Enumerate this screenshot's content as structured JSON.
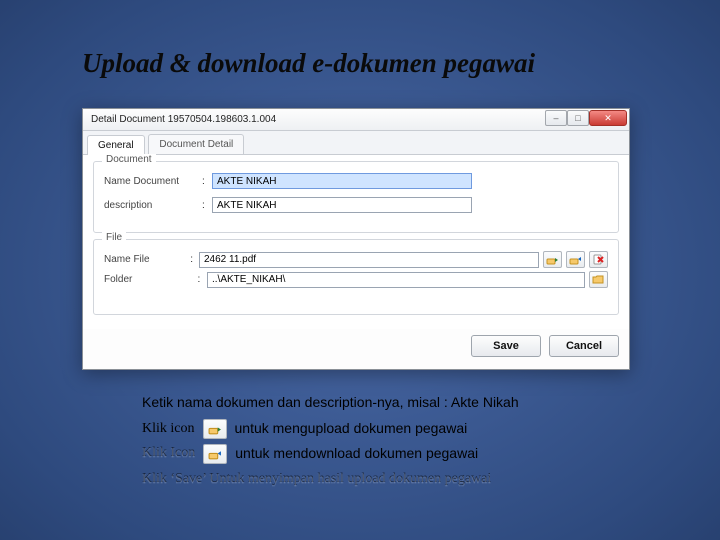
{
  "slide": {
    "title": "Upload & download e-dokumen pegawai"
  },
  "dialog": {
    "title": "Detail Document 19570504.198603.1.004",
    "tabs": {
      "general": "General",
      "detail": "Document Detail"
    },
    "group_document": "Document",
    "group_file": "File",
    "labels": {
      "name_document": "Name Document",
      "description": "description",
      "name_file": "Name File",
      "folder": "Folder",
      "colon": ":"
    },
    "values": {
      "name_document": "AKTE NIKAH",
      "description": "AKTE NIKAH",
      "name_file": "2462 11.pdf",
      "folder": "..\\AKTE_NIKAH\\"
    },
    "buttons": {
      "save": "Save",
      "cancel": "Cancel"
    }
  },
  "notes": {
    "line1": "Ketik nama dokumen dan description-nya, misal : Akte Nikah",
    "line2_prefix": "Klik icon",
    "line2_suffix": "untuk mengupload dokumen pegawai",
    "line3_prefix": "Klik Icon",
    "line3_suffix": "untuk mendownload dokumen pegawai",
    "line4": "Klik ‘Save’ Untuk menyimpan hasil upload dokumen pegawai"
  }
}
